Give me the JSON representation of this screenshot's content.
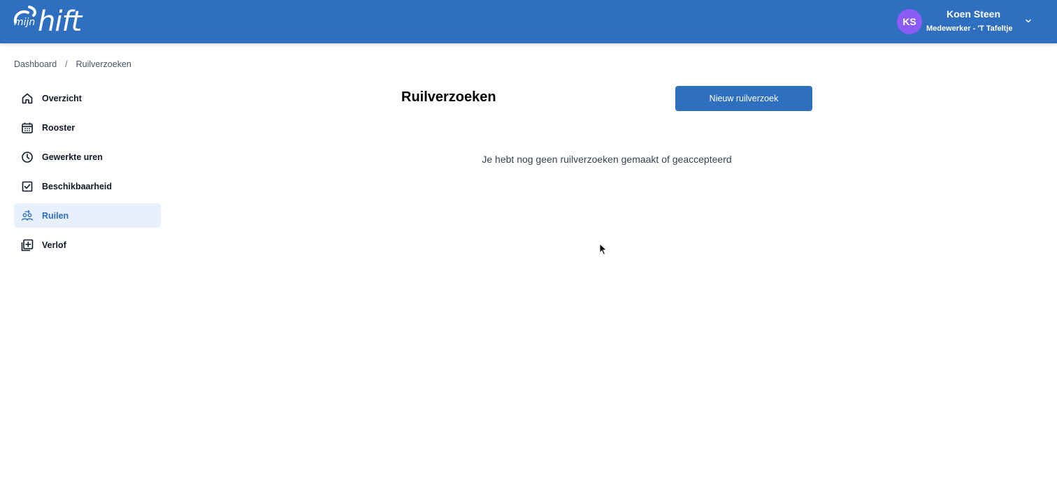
{
  "brand": {
    "prefix": "mijn",
    "word": "hift"
  },
  "user": {
    "initials": "KS",
    "name": "Koen Steen",
    "role": "Medewerker - 'T Tafeltje",
    "avatar_color": "#8b5cf6"
  },
  "colors": {
    "primary": "#2f6fc0",
    "active_bg": "#e8f1fb"
  },
  "breadcrumb": {
    "items": [
      "Dashboard",
      "Ruilverzoeken"
    ],
    "separator": "/"
  },
  "sidebar": {
    "items": [
      {
        "label": "Overzicht",
        "icon": "home-icon",
        "active": false
      },
      {
        "label": "Rooster",
        "icon": "calendar-icon",
        "active": false
      },
      {
        "label": "Gewerkte uren",
        "icon": "clock-icon",
        "active": false
      },
      {
        "label": "Beschikbaarheid",
        "icon": "checkbox-icon",
        "active": false
      },
      {
        "label": "Ruilen",
        "icon": "swap-users-icon",
        "active": true
      },
      {
        "label": "Verlof",
        "icon": "add-copy-icon",
        "active": false
      }
    ]
  },
  "main": {
    "title": "Ruilverzoeken",
    "new_button_label": "Nieuw ruilverzoek",
    "empty_message": "Je hebt nog geen ruilverzoeken gemaakt of geaccepteerd"
  }
}
